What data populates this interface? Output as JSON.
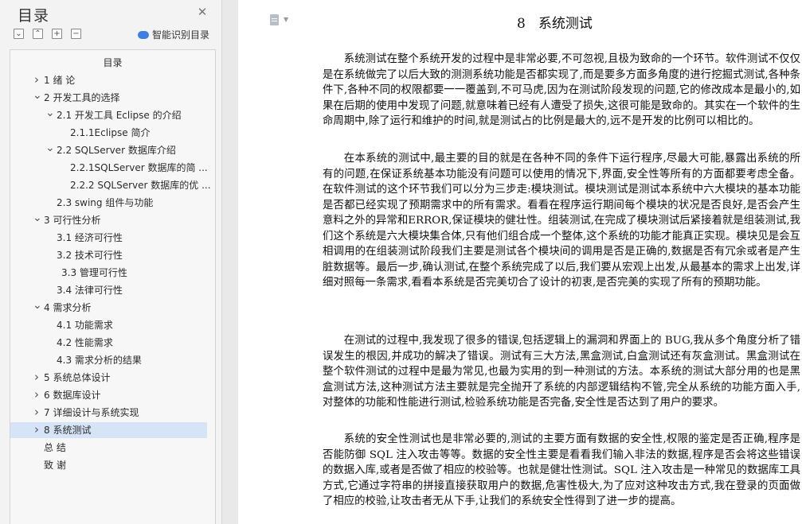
{
  "sidebar": {
    "title": "目录",
    "smart_toc_label": "智能识别目录",
    "toc_header": "目录",
    "items": [
      {
        "label": "1   绪  论",
        "level": 1,
        "chevron": "right"
      },
      {
        "label": "2    开发工具的选择",
        "level": 1,
        "chevron": "down"
      },
      {
        "label": "2.1 开发工具 Eclipse 的介绍",
        "level": 2,
        "chevron": "down"
      },
      {
        "label": "2.1.1Eclipse 简介",
        "level": 3,
        "chevron": ""
      },
      {
        "label": "2.2 SQLServer 数据库介绍",
        "level": 2,
        "chevron": "down"
      },
      {
        "label": "2.2.1SQLServer 数据库的简 ...",
        "level": 3,
        "chevron": ""
      },
      {
        "label": "2.2.2 SQLServer 数据库的优 ...",
        "level": 3,
        "chevron": ""
      },
      {
        "label": "2.3 swing 组件与功能",
        "level": 2,
        "chevron": ""
      },
      {
        "label": "3    可行性分析",
        "level": 1,
        "chevron": "down"
      },
      {
        "label": "3.1 经济可行性",
        "level": 2,
        "chevron": ""
      },
      {
        "label": "3.2 技术可行性",
        "level": 2,
        "chevron": ""
      },
      {
        "label": "3.3 管理可行性",
        "level": 2,
        "chevron": "",
        "extra": true
      },
      {
        "label": "3.4 法律可行性",
        "level": 2,
        "chevron": ""
      },
      {
        "label": "4    需求分析",
        "level": 1,
        "chevron": "down"
      },
      {
        "label": "4.1 功能需求",
        "level": 2,
        "chevron": ""
      },
      {
        "label": "4.2 性能需求",
        "level": 2,
        "chevron": ""
      },
      {
        "label": "4.3  需求分析的结果",
        "level": 2,
        "chevron": ""
      },
      {
        "label": "5    系统总体设计",
        "level": 1,
        "chevron": "right"
      },
      {
        "label": "6    数据库设计",
        "level": 1,
        "chevron": "right"
      },
      {
        "label": "7    详细设计与系统实现",
        "level": 1,
        "chevron": "right"
      },
      {
        "label": "8    系统测试",
        "level": 1,
        "chevron": "right",
        "selected": true
      },
      {
        "label": "总 结",
        "level": 0,
        "chevron": ""
      },
      {
        "label": "致 谢",
        "level": 0,
        "chevron": ""
      }
    ]
  },
  "document": {
    "heading_number": "8",
    "heading_title": "系统测试",
    "paragraphs": [
      "系统测试在整个系统开发的过程中是非常必要,不可忽视,且极为致命的一个环节。软件测试不仅仅是在系统做完了以后大致的测测系统功能是否都实现了,而是要多方面多角度的进行挖掘式测试,各种条件下,各种不同的权限都要一一覆盖到,不可马虎,因为在测试阶段发现的问题,它的修改成本是最小的,如果在后期的使用中发现了问题,就意味着已经有人遭受了损失,这很可能是致命的。其实在一个软件的生命周期中,除了运行和维护的时间,就是测试占的比例是最大的,远不是开发的比例可以相比的。",
      "在本系统的测试中,最主要的目的就是在各种不同的条件下运行程序,尽最大可能,暴露出系统的所有的问题,在保证系统基本功能没有问题可以使用的情况下,界面,安全性等所有的方面都要考虑全备。在软件测试的这个环节我们可以分为三步走:模块测试。模块测试是测试本系统中六大模块的基本功能是否都已经实现了预期需求中的所有需求。看看在程序运行期间每个模块的状况是否良好,是否会产生意料之外的异常和ERROR,保证模块的健壮性。组装测试,在完成了模块测试后紧接着就是组装测试,我们这个系统是六大模块集合体,只有他们组合成一个整体,这个系统的功能才能真正实现。模块见是会互相调用的在组装测试阶段我们主要是测试各个模块间的调用是否是正确的,数据是否有冗余或者是产生脏数据等。最后一步,确认测试,在整个系统完成了以后,我们要从宏观上出发,从最基本的需求上出发,详细对照每一条需求,看看本系统是否完美切合了设计的初衷,是否完美的实现了所有的预期功能。",
      "在测试的过程中,我发现了很多的错误,包括逻辑上的漏洞和界面上的 BUG,我从多个角度分析了错误发生的根因,并成功的解决了错误。测试有三大方法,黑盒测试,白盒测试还有灰盒测试。黑盒测试在整个软件测试的过程中是最为常见,也最为实用的到一种测试的方法。本系统的测试大部分用的也是黑盒测试方法,这种测试方法主要就是完全抛开了系统的内部逻辑结构不管,完全从系统的功能方面入手,对整体的功能和性能进行测试,检验系统功能是否完备,安全性是否达到了用户的要求。",
      "系统的安全性测试也是非常必要的,测试的主要方面有数据的安全性,权限的鉴定是否正确,程序是否能防御 SQL 注入攻击等等。数据的安全性主要是看看我们输入非法的数据,程序是否会将这些错误的数据入库,或者是否做了相应的校验等。也就是健壮性测试。SQL 注入攻击是一种常见的数据库工具方式,它通过字符串的拼接直接获取用户的数据,危害性极大,为了应对这种攻击方式,我在登录的页面做了相应的校验,让攻击者无从下手,让我们的系统安全性得到了进一步的提高。"
    ]
  }
}
